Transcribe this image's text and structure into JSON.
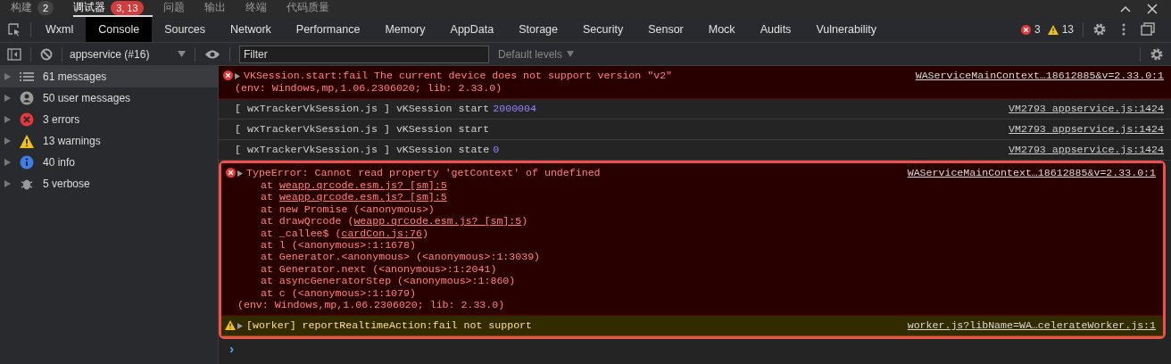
{
  "panel_tabs": [
    {
      "label": "构建",
      "badge": "2",
      "color": "#444444",
      "selected": false
    },
    {
      "label": "调试器",
      "badge": "3, 13",
      "color": "#d13c3c",
      "selected": true
    },
    {
      "label": "问题",
      "selected": false
    },
    {
      "label": "输出",
      "selected": false
    },
    {
      "label": "终端",
      "selected": false
    },
    {
      "label": "代码质量",
      "selected": false
    }
  ],
  "devtools_tabs": [
    {
      "label": "Wxml",
      "selected": false
    },
    {
      "label": "Console",
      "selected": true
    },
    {
      "label": "Sources",
      "selected": false
    },
    {
      "label": "Network",
      "selected": false
    },
    {
      "label": "Performance",
      "selected": false
    },
    {
      "label": "Memory",
      "selected": false
    },
    {
      "label": "AppData",
      "selected": false
    },
    {
      "label": "Storage",
      "selected": false
    },
    {
      "label": "Security",
      "selected": false
    },
    {
      "label": "Sensor",
      "selected": false
    },
    {
      "label": "Mock",
      "selected": false
    },
    {
      "label": "Audits",
      "selected": false
    },
    {
      "label": "Vulnerability",
      "selected": false
    }
  ],
  "counts": {
    "errors": "3",
    "warnings": "13"
  },
  "toolbar": {
    "context": "appservice (#16)",
    "filter_placeholder": "Filter",
    "levels": "Default levels"
  },
  "sidebar": [
    {
      "kind": "messages",
      "label": "61 messages",
      "selected": true
    },
    {
      "kind": "user",
      "label": "50 user messages",
      "selected": false
    },
    {
      "kind": "error",
      "label": "3 errors",
      "selected": false
    },
    {
      "kind": "warning",
      "label": "13 warnings",
      "selected": false
    },
    {
      "kind": "info",
      "label": "40 info",
      "selected": false
    },
    {
      "kind": "verbose",
      "label": "5 verbose",
      "selected": false
    }
  ],
  "messages": [
    {
      "kind": "error",
      "expandable": true,
      "highlighted": false,
      "text": "VKSession.start:fail The current device does not support version \"v2\"",
      "env": "(env: Windows,mp,1.06.2306020; lib: 2.33.0)",
      "source": "WAServiceMainContext…18612885&v=2.33.0:1"
    },
    {
      "kind": "log",
      "expandable": false,
      "highlighted": false,
      "text": "[ wxTrackerVkSession.js ] vKSession start",
      "number": "2000004",
      "source": "VM2793 appservice.js:1424"
    },
    {
      "kind": "log",
      "expandable": false,
      "highlighted": false,
      "text": "[ wxTrackerVkSession.js ] vKSession start",
      "source": "VM2793 appservice.js:1424"
    },
    {
      "kind": "log",
      "expandable": false,
      "highlighted": false,
      "text": "[ wxTrackerVkSession.js ] vKSession state",
      "number": "0",
      "source": "VM2793 appservice.js:1424"
    },
    {
      "kind": "error",
      "expandable": true,
      "highlighted": true,
      "text": "TypeError: Cannot read property 'getContext' of undefined",
      "stack": [
        {
          "pre": "at ",
          "link": "weapp.qrcode.esm.js? [sm]:5"
        },
        {
          "pre": "at ",
          "link": "weapp.qrcode.esm.js? [sm]:5"
        },
        {
          "pre": "at new Promise (<anonymous>)"
        },
        {
          "pre": "at drawQrcode (",
          "link": "weapp.qrcode.esm.js? [sm]:5",
          "post": ")"
        },
        {
          "pre": "at _callee$ (",
          "link": "cardCon.js:76",
          "post": ")"
        },
        {
          "pre": "at l (<anonymous>:1:1678)"
        },
        {
          "pre": "at Generator.<anonymous> (<anonymous>:1:3039)"
        },
        {
          "pre": "at Generator.next (<anonymous>:1:2041)"
        },
        {
          "pre": "at asyncGeneratorStep (<anonymous>:1:860)"
        },
        {
          "pre": "at c (<anonymous>:1:1079)"
        }
      ],
      "env": "(env: Windows,mp,1.06.2306020; lib: 2.33.0)",
      "source": "WAServiceMainContext…18612885&v=2.33.0:1"
    },
    {
      "kind": "warning",
      "expandable": true,
      "highlighted": true,
      "text": "[worker] reportRealtimeAction:fail not support",
      "source": "worker.js?libName=WA…celerateWorker.js:1"
    }
  ],
  "prompt": "›"
}
